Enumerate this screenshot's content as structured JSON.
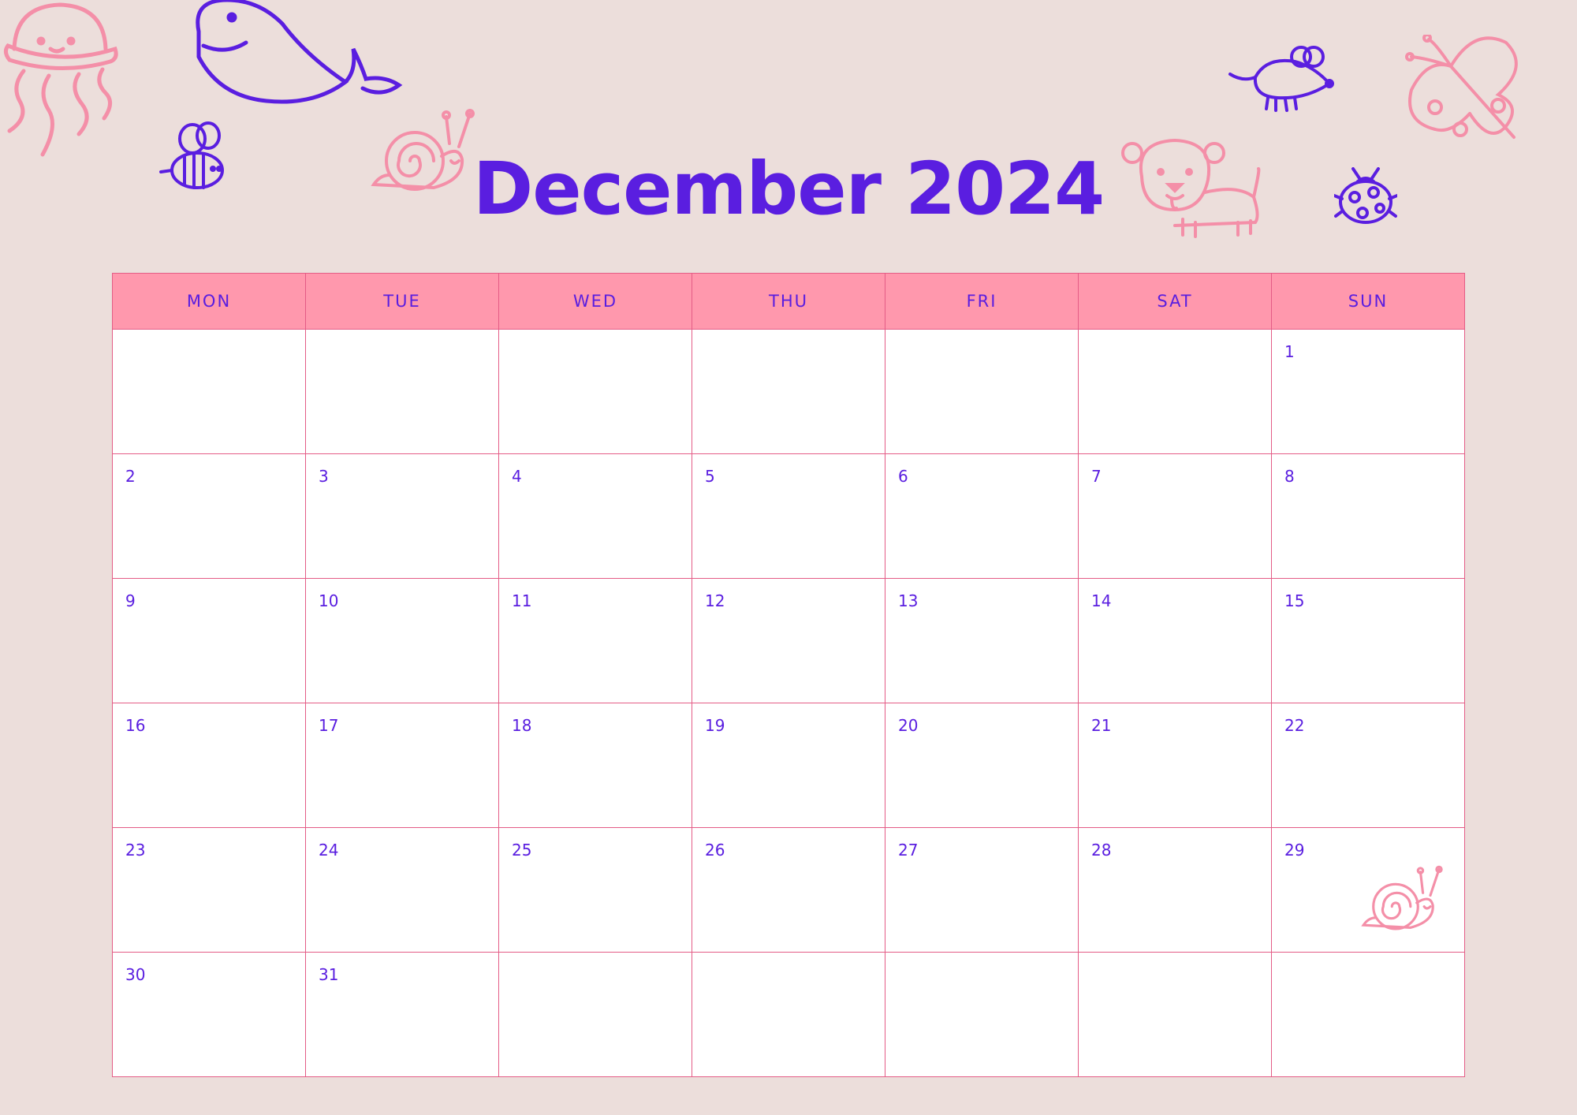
{
  "calendar": {
    "title": "December 2024",
    "weekdays": [
      "MON",
      "TUE",
      "WED",
      "THU",
      "FRI",
      "SAT",
      "SUN"
    ],
    "weeks": [
      [
        "",
        "",
        "",
        "",
        "",
        "",
        "1"
      ],
      [
        "2",
        "3",
        "4",
        "5",
        "6",
        "7",
        "8"
      ],
      [
        "9",
        "10",
        "11",
        "12",
        "13",
        "14",
        "15"
      ],
      [
        "16",
        "17",
        "18",
        "19",
        "20",
        "21",
        "22"
      ],
      [
        "23",
        "24",
        "25",
        "26",
        "27",
        "28",
        "29"
      ],
      [
        "30",
        "31",
        "",
        "",
        "",
        "",
        ""
      ]
    ]
  },
  "colors": {
    "background": "#ecdedb",
    "accent_purple": "#5a1ee0",
    "header_pink": "#ff98ad",
    "grid_line": "#e45c86",
    "doodle_pink": "#f48fa8"
  },
  "decorations": [
    "jellyfish-icon",
    "whale-icon",
    "bee-icon",
    "snail-icon",
    "mouse-icon",
    "butterfly-icon",
    "dog-icon",
    "ladybug-icon"
  ]
}
